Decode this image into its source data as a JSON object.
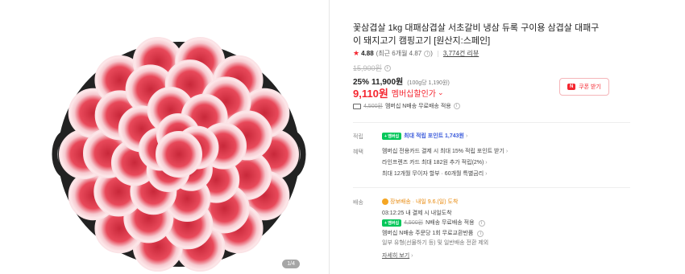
{
  "gallery": {
    "pager": "1/4"
  },
  "product": {
    "title": "꽃삼겹살 1kg 대패삼겹살 서초갈비 냉삼 듀록 구이용 삼겹살 대패구이 돼지고기 캠핑고기 [원산지:스페인]",
    "rating": {
      "score": "4.88",
      "recent": "(최근 6개월 4.87",
      "recent_close": ")",
      "reviews": "3,774건 리뷰"
    },
    "original_price": "15,900원",
    "discount": "25%",
    "sale_price": "11,900원",
    "unit_price": "(100g당 1,190원)",
    "member_price": "9,110원",
    "member_label": "멤버십할인가",
    "coupon_label": "쿠폰 받기",
    "coupon_icon": "N",
    "shipping_fee_strike": "4,500원",
    "shipping_text": "멤버십 N배송 무료배송 적용"
  },
  "points": {
    "label": "적립",
    "badge": "+ 멤버십",
    "text": "최대 적립 포인트 1,743원"
  },
  "benefits": {
    "label": "혜택",
    "lines": [
      "멤버십 전용카드 결제 시 최대 15% 적립 포인트 받기",
      "라인프렌즈 카드 최대 182원 추가 적립(2%)",
      "최대 12개월 무이자 할부 · 60개월 특별금리"
    ]
  },
  "delivery": {
    "label": "배송",
    "arrival": "장보배송 · 내일 9.6.(일) 도착",
    "cutoff": "03:12:25  내 결제 시 내일도착",
    "badge": "+ 멤버십",
    "fee_strike": "4,500원",
    "fee_text": "N배송 무료배송 적용",
    "exchange": "멤버십 N배송 주문당 1회 무료교환반품",
    "exclusion": "일부 유형(선물하기 등) 및 일반배송 전환 제외",
    "more": "자세히 보기"
  },
  "colors": {
    "accent_red": "#f4252f",
    "naver_green": "#03c75a",
    "link_blue": "#3b5bdb"
  }
}
